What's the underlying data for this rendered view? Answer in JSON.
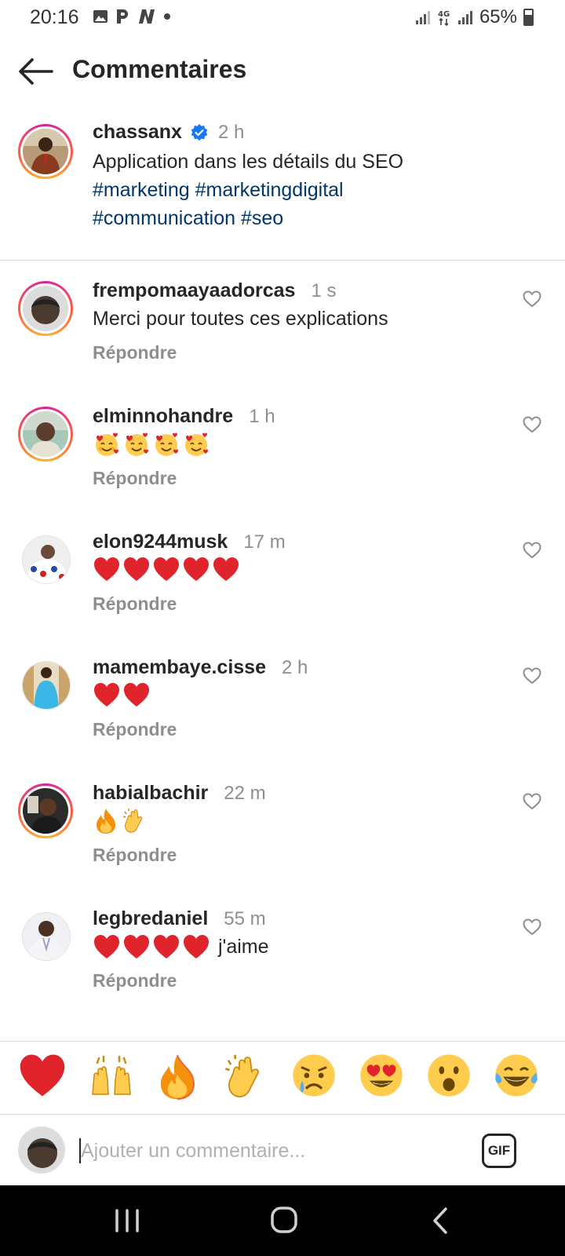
{
  "status_bar": {
    "time": "20:16",
    "battery": "65%"
  },
  "header": {
    "title": "Commentaires"
  },
  "caption": {
    "username": "chassanx",
    "time": "2 h",
    "text": "Application dans les détails du SEO",
    "hashtags_line1": "#marketing #marketingdigital",
    "hashtags_line2": "#communication #seo"
  },
  "comments": [
    {
      "username": "frempomaayaadorcas",
      "time": "1 s",
      "text": "Merci pour toutes ces explications",
      "reply": "Répondre"
    },
    {
      "username": "elminnohandre",
      "time": "1 h",
      "emoji_count": 4,
      "emoji": "smiling-face-with-hearts",
      "reply": "Répondre"
    },
    {
      "username": "elon9244musk",
      "time": "17 m",
      "emoji_count": 5,
      "emoji": "red-heart",
      "reply": "Répondre"
    },
    {
      "username": "mamembaye.cisse",
      "time": "2 h",
      "emoji_count": 2,
      "emoji": "red-heart",
      "reply": "Répondre"
    },
    {
      "username": "habialbachir",
      "time": "22 m",
      "emojis": [
        "fire",
        "clapping-hands"
      ],
      "reply": "Répondre"
    },
    {
      "username": "legbredaniel",
      "time": "55 m",
      "emoji_count": 4,
      "emoji": "red-heart",
      "text": "j'aime",
      "reply": "Répondre"
    }
  ],
  "emoji_bar": [
    "red-heart",
    "raising-hands",
    "fire",
    "clapping-hands",
    "crying-face",
    "heart-eyes",
    "open-mouth",
    "tears-of-joy"
  ],
  "input": {
    "placeholder": "Ajouter un commentaire...",
    "gif_label": "GIF"
  },
  "colors": {
    "hashtag": "#00376b",
    "muted": "#8e8e8e",
    "verified": "#1877f2",
    "heart": "#e0242c"
  }
}
